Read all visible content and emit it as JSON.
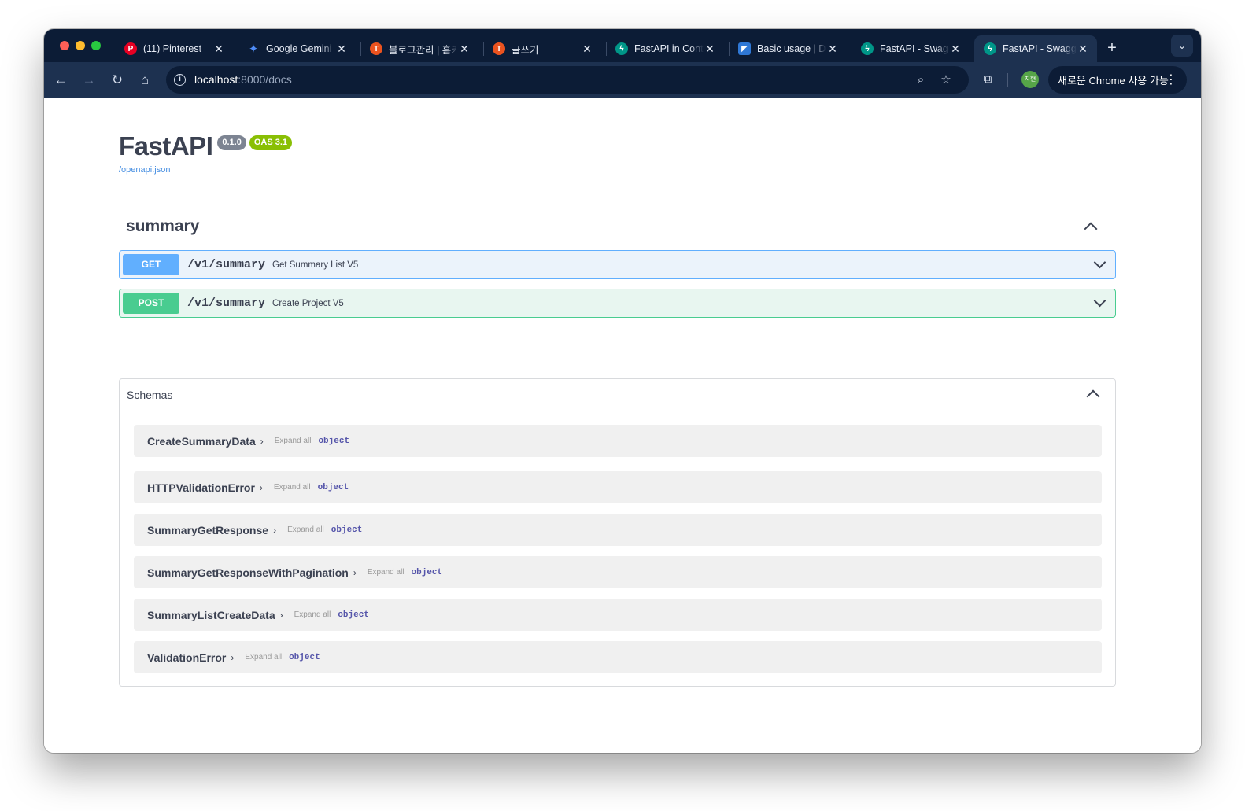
{
  "browser": {
    "tabs": [
      {
        "title": "(11) Pinterest",
        "icon": "pinterest-icon",
        "color": "#e60023"
      },
      {
        "title": "Google Gemini",
        "icon": "gemini-icon",
        "color": "#4f8cf7"
      },
      {
        "title": "블로그관리 | 홈키파",
        "icon": "tistory-icon",
        "color": "#eb531f"
      },
      {
        "title": "글쓰기",
        "icon": "tistory-icon",
        "color": "#eb531f"
      },
      {
        "title": "FastAPI in Containers",
        "icon": "fastapi-icon",
        "color": "#009688"
      },
      {
        "title": "Basic usage | Docs",
        "icon": "docs-icon",
        "color": "#2f78d6"
      },
      {
        "title": "FastAPI - Swagger UI",
        "icon": "fastapi-icon",
        "color": "#009688"
      },
      {
        "title": "FastAPI - Swagger UI",
        "icon": "fastapi-icon",
        "color": "#009688"
      }
    ],
    "active_tab": 7,
    "address_host": "localhost",
    "address_rest": ":8000/docs",
    "avatar_label": "지현",
    "update_label": "새로운 Chrome 사용 가능"
  },
  "api": {
    "title": "FastAPI",
    "version": "0.1.0",
    "oas": "OAS 3.1",
    "spec_link": "/openapi.json"
  },
  "tag": {
    "name": "summary",
    "operations": [
      {
        "method": "GET",
        "path": "/v1/summary",
        "summary": "Get Summary List V5"
      },
      {
        "method": "POST",
        "path": "/v1/summary",
        "summary": "Create Project V5"
      }
    ]
  },
  "schemas": {
    "title": "Schemas",
    "expand_label": "Expand all",
    "models": [
      {
        "name": "CreateSummaryData",
        "type": "object"
      },
      {
        "name": "HTTPValidationError",
        "type": "object"
      },
      {
        "name": "SummaryGetResponse",
        "type": "object"
      },
      {
        "name": "SummaryGetResponseWithPagination",
        "type": "object"
      },
      {
        "name": "SummaryListCreateData",
        "type": "object"
      },
      {
        "name": "ValidationError",
        "type": "object"
      }
    ]
  },
  "colors": {
    "get": "#61affe",
    "post": "#49cc90",
    "chrome_dark": "#0c1c36",
    "chrome_toolbar": "#1d3150"
  }
}
